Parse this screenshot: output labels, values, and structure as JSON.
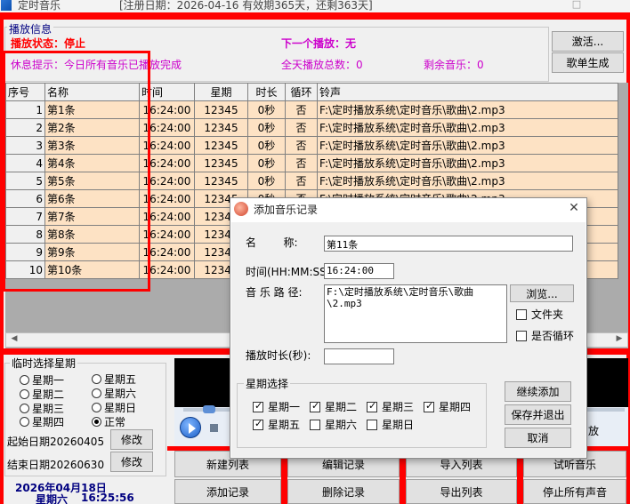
{
  "window": {
    "title": "定时音乐",
    "registration": "[注册日期：2026-04-16   有效期365天，还剩363天]"
  },
  "info": {
    "legend": "播放信息",
    "play_status": "播放状态：停止",
    "next_play": "下一个播放：无",
    "rest_hint": "休息提示：今日所有音乐已播放完成",
    "total_count": "全天播放总数：0",
    "remaining": "剩余音乐：0",
    "activate_btn": "激活...",
    "playlist_btn": "歌单生成"
  },
  "table": {
    "columns": [
      "序号",
      "名称",
      "时间",
      "星期",
      "时长",
      "循环",
      "铃声"
    ],
    "rows": [
      [
        "1",
        "第1条",
        "16:24:00",
        "12345",
        "0秒",
        "否",
        "F:\\定时播放系统\\定时音乐\\歌曲\\2.mp3"
      ],
      [
        "2",
        "第2条",
        "16:24:00",
        "12345",
        "0秒",
        "否",
        "F:\\定时播放系统\\定时音乐\\歌曲\\2.mp3"
      ],
      [
        "3",
        "第3条",
        "16:24:00",
        "12345",
        "0秒",
        "否",
        "F:\\定时播放系统\\定时音乐\\歌曲\\2.mp3"
      ],
      [
        "4",
        "第4条",
        "16:24:00",
        "12345",
        "0秒",
        "否",
        "F:\\定时播放系统\\定时音乐\\歌曲\\2.mp3"
      ],
      [
        "5",
        "第5条",
        "16:24:00",
        "12345",
        "0秒",
        "否",
        "F:\\定时播放系统\\定时音乐\\歌曲\\2.mp3"
      ],
      [
        "6",
        "第6条",
        "16:24:00",
        "12345",
        "0秒",
        "否",
        "F:\\定时播放系统\\定时音乐\\歌曲\\2.mp3"
      ],
      [
        "7",
        "第7条",
        "16:24:00",
        "12345",
        "",
        "",
        ""
      ],
      [
        "8",
        "第8条",
        "16:24:00",
        "12345",
        "",
        "",
        ""
      ],
      [
        "9",
        "第9条",
        "16:24:00",
        "12345",
        "",
        "",
        ""
      ],
      [
        "10",
        "第10条",
        "16:24:00",
        "12345",
        "",
        "",
        ""
      ]
    ]
  },
  "week_select": {
    "legend": "临时选择星期",
    "options": [
      "星期一",
      "星期二",
      "星期三",
      "星期四",
      "星期五",
      "星期六",
      "星期日",
      "正常"
    ],
    "selected": "正常",
    "start_date": "起始日期20260405",
    "end_date": "结束日期20260630",
    "modify": "修改"
  },
  "clock": {
    "date": "2026年04月18日",
    "weekday": "星期六",
    "time": "16:25:56"
  },
  "player": {
    "clip_text": "放"
  },
  "actions": {
    "new_list": "新建列表",
    "edit_record": "编辑记录",
    "import_list": "导入列表",
    "audition": "试听音乐",
    "add_record": "添加记录",
    "delete_record": "删除记录",
    "export_list": "导出列表",
    "stop_all": "停止所有声音"
  },
  "dialog": {
    "title": "添加音乐记录",
    "name_label": "名        称:",
    "name_value": "第11条",
    "time_label": "时间(HH:MM:SS):",
    "time_value": "16:24:00",
    "path_label": "音 乐 路 径:",
    "path_value": "F:\\定时播放系统\\定时音乐\\歌曲\n\\2.mp3",
    "browse": "浏览...",
    "folder": "文件夹",
    "loop": "是否循环",
    "duration_label": "播放时长(秒):",
    "duration_value": "",
    "week_legend": "星期选择",
    "weekdays": [
      {
        "label": "星期一",
        "checked": true
      },
      {
        "label": "星期二",
        "checked": true
      },
      {
        "label": "星期三",
        "checked": true
      },
      {
        "label": "星期四",
        "checked": true
      },
      {
        "label": "星期五",
        "checked": true
      },
      {
        "label": "星期六",
        "checked": false
      },
      {
        "label": "星期日",
        "checked": false
      }
    ],
    "continue_add": "继续添加",
    "save_exit": "保存并退出",
    "cancel": "取消"
  },
  "colors": {
    "accent_red": "#ff0000",
    "row_fill": "#fde2c4",
    "info_magenta": "#cc00cc",
    "clock_navy": "#000080"
  }
}
